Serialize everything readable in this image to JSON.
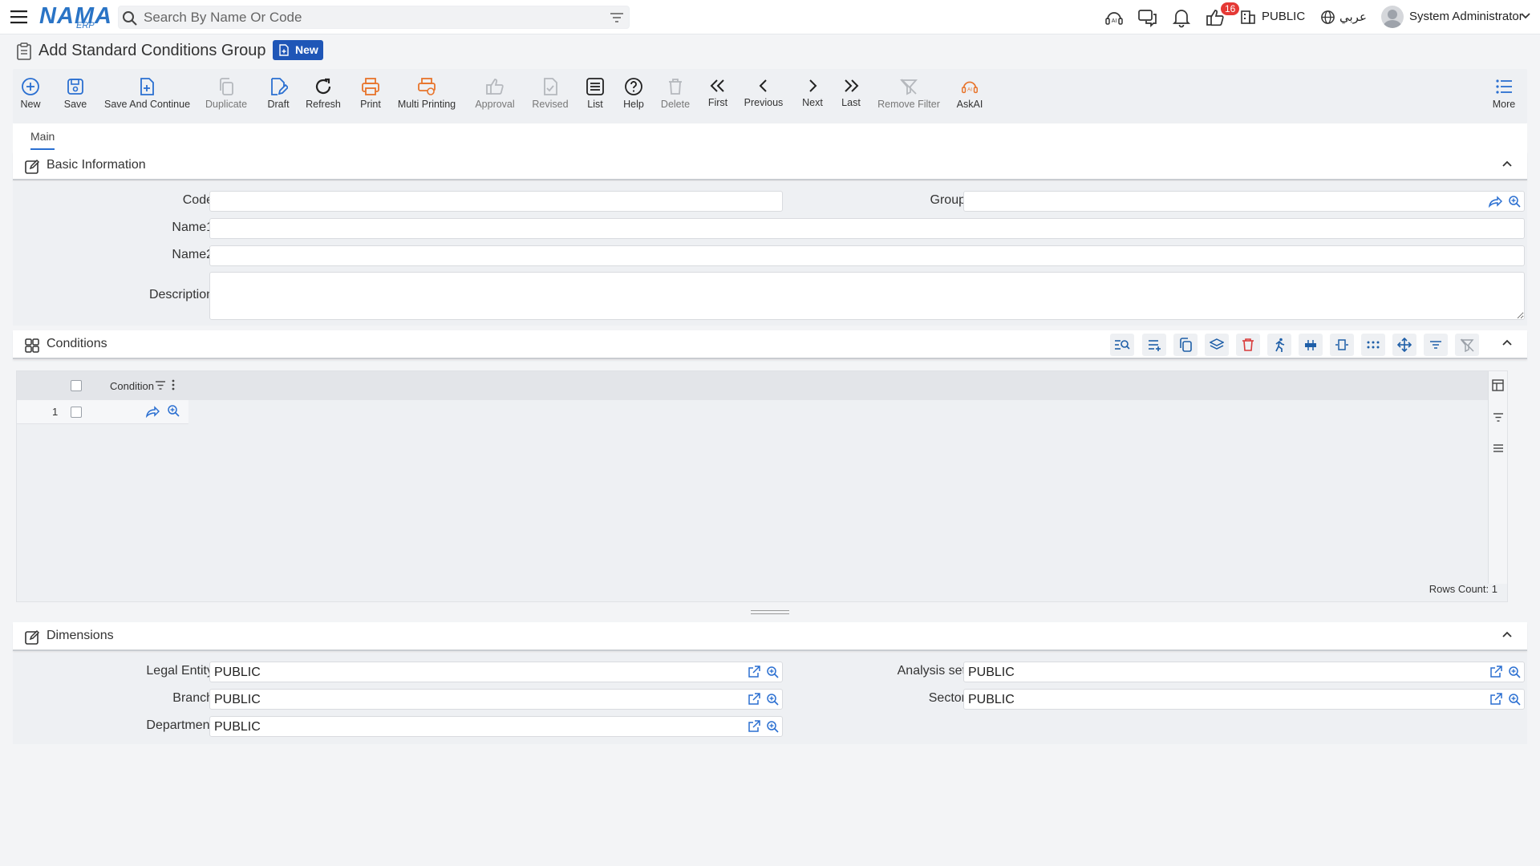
{
  "app": {
    "logo": "NAMA",
    "logo_sub": "ERP"
  },
  "search": {
    "placeholder": "Search By Name Or Code"
  },
  "topbar": {
    "notifications_count": "16",
    "company": "PUBLIC",
    "language": "عربي",
    "user": "System Administrator"
  },
  "page": {
    "title": "Add Standard Conditions Group",
    "status": "New"
  },
  "toolbar": {
    "new": "New",
    "save": "Save",
    "save_continue": "Save And Continue",
    "duplicate": "Duplicate",
    "draft": "Draft",
    "refresh": "Refresh",
    "print": "Print",
    "multi_printing": "Multi Printing",
    "approval": "Approval",
    "revised": "Revised",
    "list": "List",
    "help": "Help",
    "delete": "Delete",
    "first": "First",
    "previous": "Previous",
    "next": "Next",
    "last": "Last",
    "remove_filter": "Remove Filter",
    "askai": "AskAI",
    "more": "More"
  },
  "tabs": {
    "main": "Main"
  },
  "basic_info": {
    "title": "Basic Information",
    "code_label": "Code",
    "code_value": "",
    "group_label": "Group",
    "group_value": "",
    "name1_label": "Name1",
    "name1_value": "",
    "name2_label": "Name2",
    "name2_value": "",
    "description_label": "Description",
    "description_value": ""
  },
  "conditions": {
    "title": "Conditions",
    "column_condition": "Condition",
    "rows": [
      {
        "index": "1",
        "condition": ""
      }
    ],
    "rows_count_label": "Rows Count:",
    "rows_count": "1"
  },
  "dimensions": {
    "title": "Dimensions",
    "legal_entity_label": "Legal Entity",
    "legal_entity_value": "PUBLIC",
    "branch_label": "Branch",
    "branch_value": "PUBLIC",
    "department_label": "Department",
    "department_value": "PUBLIC",
    "analysis_set_label": "Analysis set",
    "analysis_set_value": "PUBLIC",
    "sector_label": "Sector",
    "sector_value": "PUBLIC"
  },
  "colors": {
    "accent": "#2a6fd1",
    "orange": "#e8742b",
    "badge": "#1f56b7",
    "alert": "#e53935"
  }
}
